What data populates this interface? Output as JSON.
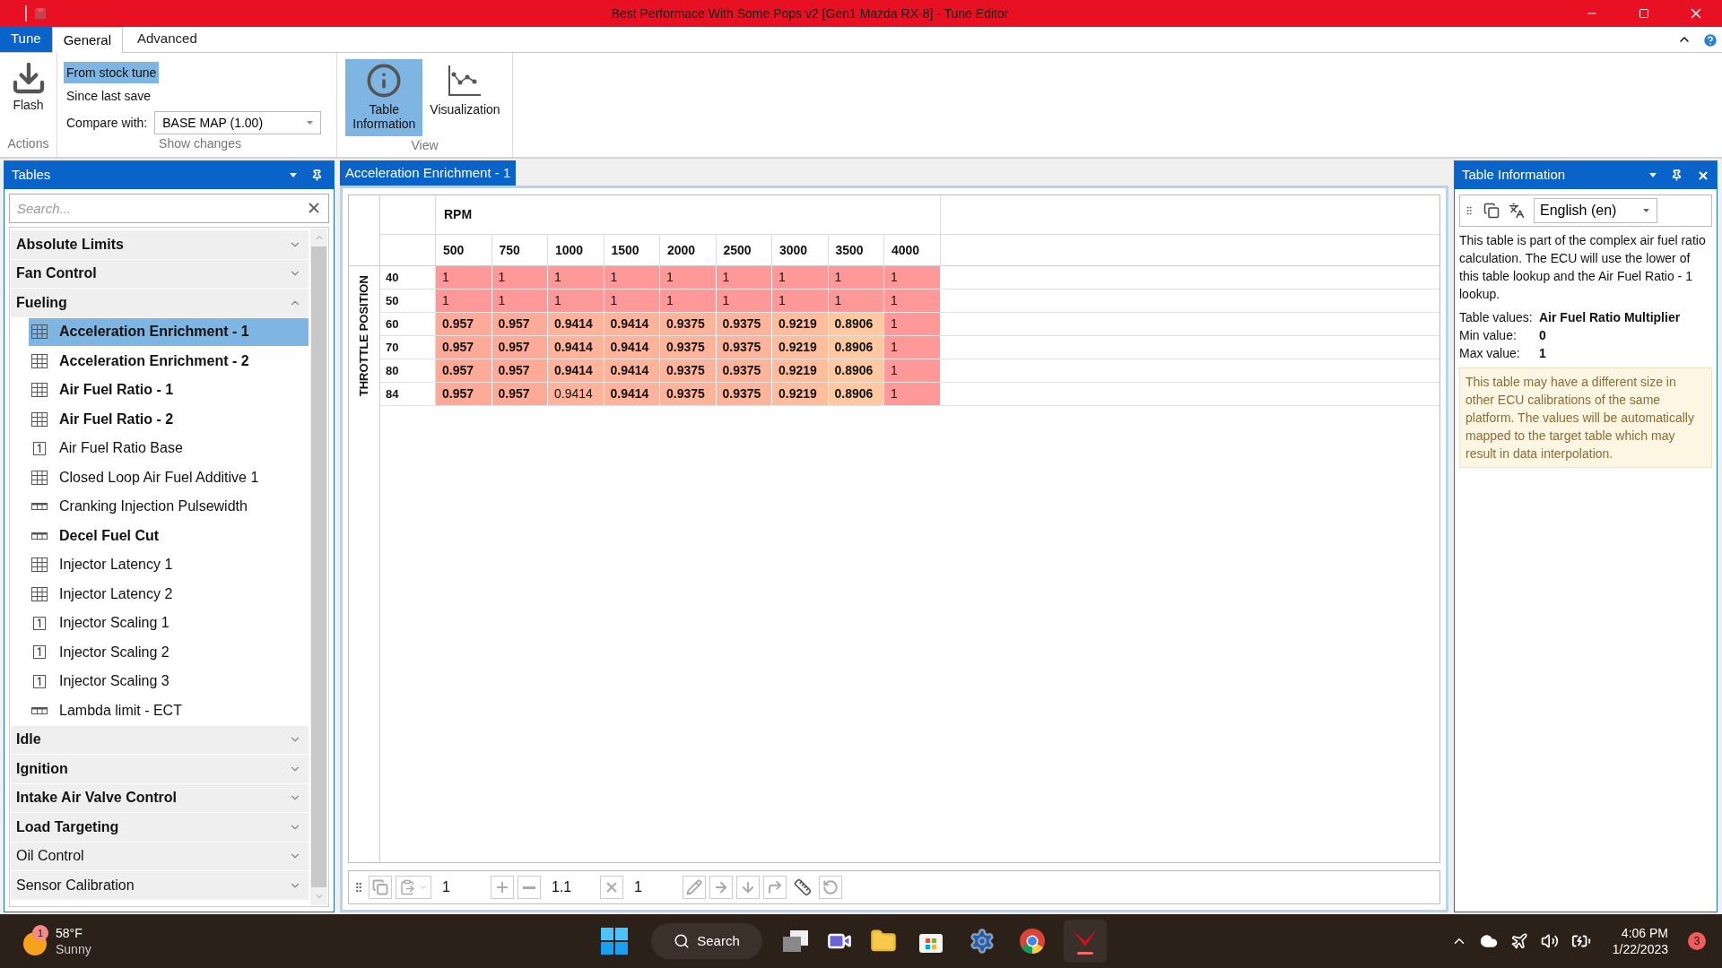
{
  "window": {
    "title": "Best Performace With Some Pops v2 [Gen1 Mazda RX-8] - Tune Editor"
  },
  "ribbon": {
    "app_menu": "Tune",
    "tabs": [
      {
        "label": "General",
        "selected": true
      },
      {
        "label": "Advanced",
        "selected": false
      }
    ],
    "actions": {
      "flash": "Flash",
      "label": "Actions"
    },
    "show_changes": {
      "options": [
        {
          "label": "From stock tune",
          "selected": true
        },
        {
          "label": "Since last save",
          "selected": false
        }
      ],
      "compare_label": "Compare with:",
      "compare_value": "BASE MAP (1.00)",
      "label": "Show changes"
    },
    "view": {
      "buttons": [
        {
          "kind": "info",
          "label": "Table Information",
          "selected": true
        },
        {
          "kind": "chart",
          "label": "Visualization",
          "selected": false
        }
      ],
      "label": "View"
    }
  },
  "tables_panel": {
    "title": "Tables",
    "search": {
      "placeholder": "Search..."
    },
    "groups": [
      {
        "label": "Absolute Limits",
        "changed": true,
        "expanded": false
      },
      {
        "label": "Fan Control",
        "changed": true,
        "expanded": false
      },
      {
        "label": "Fueling",
        "changed": true,
        "expanded": true,
        "children": [
          {
            "label": "Acceleration Enrichment - 1",
            "kind": "table",
            "changed": true,
            "selected": true
          },
          {
            "label": "Acceleration Enrichment - 2",
            "kind": "table",
            "changed": true,
            "selected": false
          },
          {
            "label": "Air Fuel Ratio - 1",
            "kind": "table",
            "changed": true,
            "selected": false
          },
          {
            "label": "Air Fuel Ratio - 2",
            "kind": "table",
            "changed": true,
            "selected": false
          },
          {
            "label": "Air Fuel Ratio Base",
            "kind": "value",
            "changed": false,
            "selected": false
          },
          {
            "label": "Closed Loop Air Fuel Additive 1",
            "kind": "table",
            "changed": false,
            "selected": false
          },
          {
            "label": "Cranking Injection Pulsewidth",
            "kind": "row",
            "changed": false,
            "selected": false
          },
          {
            "label": "Decel Fuel Cut",
            "kind": "row",
            "changed": true,
            "selected": false
          },
          {
            "label": "Injector Latency 1",
            "kind": "table",
            "changed": false,
            "selected": false
          },
          {
            "label": "Injector Latency 2",
            "kind": "table",
            "changed": false,
            "selected": false
          },
          {
            "label": "Injector Scaling 1",
            "kind": "value",
            "changed": false,
            "selected": false
          },
          {
            "label": "Injector Scaling 2",
            "kind": "value",
            "changed": false,
            "selected": false
          },
          {
            "label": "Injector Scaling 3",
            "kind": "value",
            "changed": false,
            "selected": false
          },
          {
            "label": "Lambda limit - ECT",
            "kind": "row",
            "changed": false,
            "selected": false
          }
        ]
      },
      {
        "label": "Idle",
        "changed": true,
        "expanded": false
      },
      {
        "label": "Ignition",
        "changed": true,
        "expanded": false
      },
      {
        "label": "Intake Air Valve Control",
        "changed": true,
        "expanded": false
      },
      {
        "label": "Load Targeting",
        "changed": true,
        "expanded": false
      },
      {
        "label": "Oil Control",
        "changed": false,
        "expanded": false
      },
      {
        "label": "Sensor Calibration",
        "changed": false,
        "expanded": false
      }
    ]
  },
  "editor": {
    "tab": "Acceleration Enrichment - 1",
    "x_axis": "RPM",
    "y_axis": "THROTTLE POSITION",
    "columns": [
      "500",
      "750",
      "1000",
      "1500",
      "2000",
      "2500",
      "3000",
      "3500",
      "4000"
    ],
    "rows": [
      {
        "label": "40",
        "cells": [
          {
            "value": "1",
            "changed": false,
            "color": "#ff9999"
          },
          {
            "value": "1",
            "changed": false,
            "color": "#ff9999"
          },
          {
            "value": "1",
            "changed": false,
            "color": "#ff9999"
          },
          {
            "value": "1",
            "changed": false,
            "color": "#ff9999"
          },
          {
            "value": "1",
            "changed": false,
            "color": "#ff9999"
          },
          {
            "value": "1",
            "changed": false,
            "color": "#ff9999"
          },
          {
            "value": "1",
            "changed": false,
            "color": "#ff9999"
          },
          {
            "value": "1",
            "changed": false,
            "color": "#ff9999"
          },
          {
            "value": "1",
            "changed": false,
            "color": "#ff9999"
          }
        ]
      },
      {
        "label": "50",
        "cells": [
          {
            "value": "1",
            "changed": false,
            "color": "#ff9999"
          },
          {
            "value": "1",
            "changed": false,
            "color": "#ff9999"
          },
          {
            "value": "1",
            "changed": false,
            "color": "#ff9999"
          },
          {
            "value": "1",
            "changed": false,
            "color": "#ff9999"
          },
          {
            "value": "1",
            "changed": false,
            "color": "#ff9999"
          },
          {
            "value": "1",
            "changed": false,
            "color": "#ff9999"
          },
          {
            "value": "1",
            "changed": false,
            "color": "#ff9999"
          },
          {
            "value": "1",
            "changed": false,
            "color": "#ff9999"
          },
          {
            "value": "1",
            "changed": false,
            "color": "#ff9999"
          }
        ]
      },
      {
        "label": "60",
        "cells": [
          {
            "value": "0.957",
            "changed": true,
            "color": "#feaa98"
          },
          {
            "value": "0.957",
            "changed": true,
            "color": "#feaa98"
          },
          {
            "value": "0.9414",
            "changed": true,
            "color": "#feb39a"
          },
          {
            "value": "0.9414",
            "changed": true,
            "color": "#feb39a"
          },
          {
            "value": "0.9375",
            "changed": true,
            "color": "#feb49b"
          },
          {
            "value": "0.9375",
            "changed": true,
            "color": "#feb49b"
          },
          {
            "value": "0.9219",
            "changed": true,
            "color": "#febd9d"
          },
          {
            "value": "0.8906",
            "changed": true,
            "color": "#fec9a0"
          },
          {
            "value": "1",
            "changed": false,
            "color": "#ff9999"
          }
        ]
      },
      {
        "label": "70",
        "cells": [
          {
            "value": "0.957",
            "changed": true,
            "color": "#feaa98"
          },
          {
            "value": "0.957",
            "changed": true,
            "color": "#feaa98"
          },
          {
            "value": "0.9414",
            "changed": true,
            "color": "#feb39a"
          },
          {
            "value": "0.9414",
            "changed": true,
            "color": "#feb39a"
          },
          {
            "value": "0.9375",
            "changed": true,
            "color": "#feb49b"
          },
          {
            "value": "0.9375",
            "changed": true,
            "color": "#feb49b"
          },
          {
            "value": "0.9219",
            "changed": true,
            "color": "#febd9d"
          },
          {
            "value": "0.8906",
            "changed": true,
            "color": "#fec9a0"
          },
          {
            "value": "1",
            "changed": false,
            "color": "#ff9999"
          }
        ]
      },
      {
        "label": "80",
        "cells": [
          {
            "value": "0.957",
            "changed": true,
            "color": "#feaa98"
          },
          {
            "value": "0.957",
            "changed": true,
            "color": "#feaa98"
          },
          {
            "value": "0.9414",
            "changed": true,
            "color": "#feb39a"
          },
          {
            "value": "0.9414",
            "changed": true,
            "color": "#feb39a"
          },
          {
            "value": "0.9375",
            "changed": true,
            "color": "#feb49b"
          },
          {
            "value": "0.9375",
            "changed": true,
            "color": "#feb49b"
          },
          {
            "value": "0.9219",
            "changed": true,
            "color": "#febd9d"
          },
          {
            "value": "0.8906",
            "changed": true,
            "color": "#fec9a0"
          },
          {
            "value": "1",
            "changed": false,
            "color": "#ff9999"
          }
        ]
      },
      {
        "label": "84",
        "cells": [
          {
            "value": "0.957",
            "changed": true,
            "color": "#feaa98"
          },
          {
            "value": "0.957",
            "changed": true,
            "color": "#feaa98"
          },
          {
            "value": "0.9414",
            "changed": false,
            "color": "#feb39a"
          },
          {
            "value": "0.9414",
            "changed": true,
            "color": "#feb39a"
          },
          {
            "value": "0.9375",
            "changed": true,
            "color": "#feb49b"
          },
          {
            "value": "0.9375",
            "changed": true,
            "color": "#feb49b"
          },
          {
            "value": "0.9219",
            "changed": true,
            "color": "#febd9d"
          },
          {
            "value": "0.8906",
            "changed": true,
            "color": "#fec9a0"
          },
          {
            "value": "1",
            "changed": false,
            "color": "#ff9999"
          }
        ]
      }
    ],
    "toolbar": {
      "inputs": [
        "1",
        "1.1",
        "1"
      ]
    }
  },
  "info_panel": {
    "title": "Table Information",
    "language": "English (en)",
    "description": "This table is part of the complex air fuel ratio calculation.  The ECU will use the lower of this table lookup and the Air Fuel Ratio - 1 lookup.",
    "properties": [
      {
        "label": "Table values:",
        "value": "Air Fuel Ratio Multiplier"
      },
      {
        "label": "Min value:",
        "value": "0"
      },
      {
        "label": "Max value:",
        "value": "1"
      }
    ],
    "note": "This table may have a different size in other ECU calibrations of the same platform. The values will be automatically mapped to the target table which may result in data interpolation."
  },
  "taskbar": {
    "weather": {
      "badge": "1",
      "temperature": "58°F",
      "condition": "Sunny"
    },
    "search": "Search",
    "clock": {
      "time": "4:06 PM",
      "date": "1/22/2023"
    },
    "notifications": "3"
  }
}
